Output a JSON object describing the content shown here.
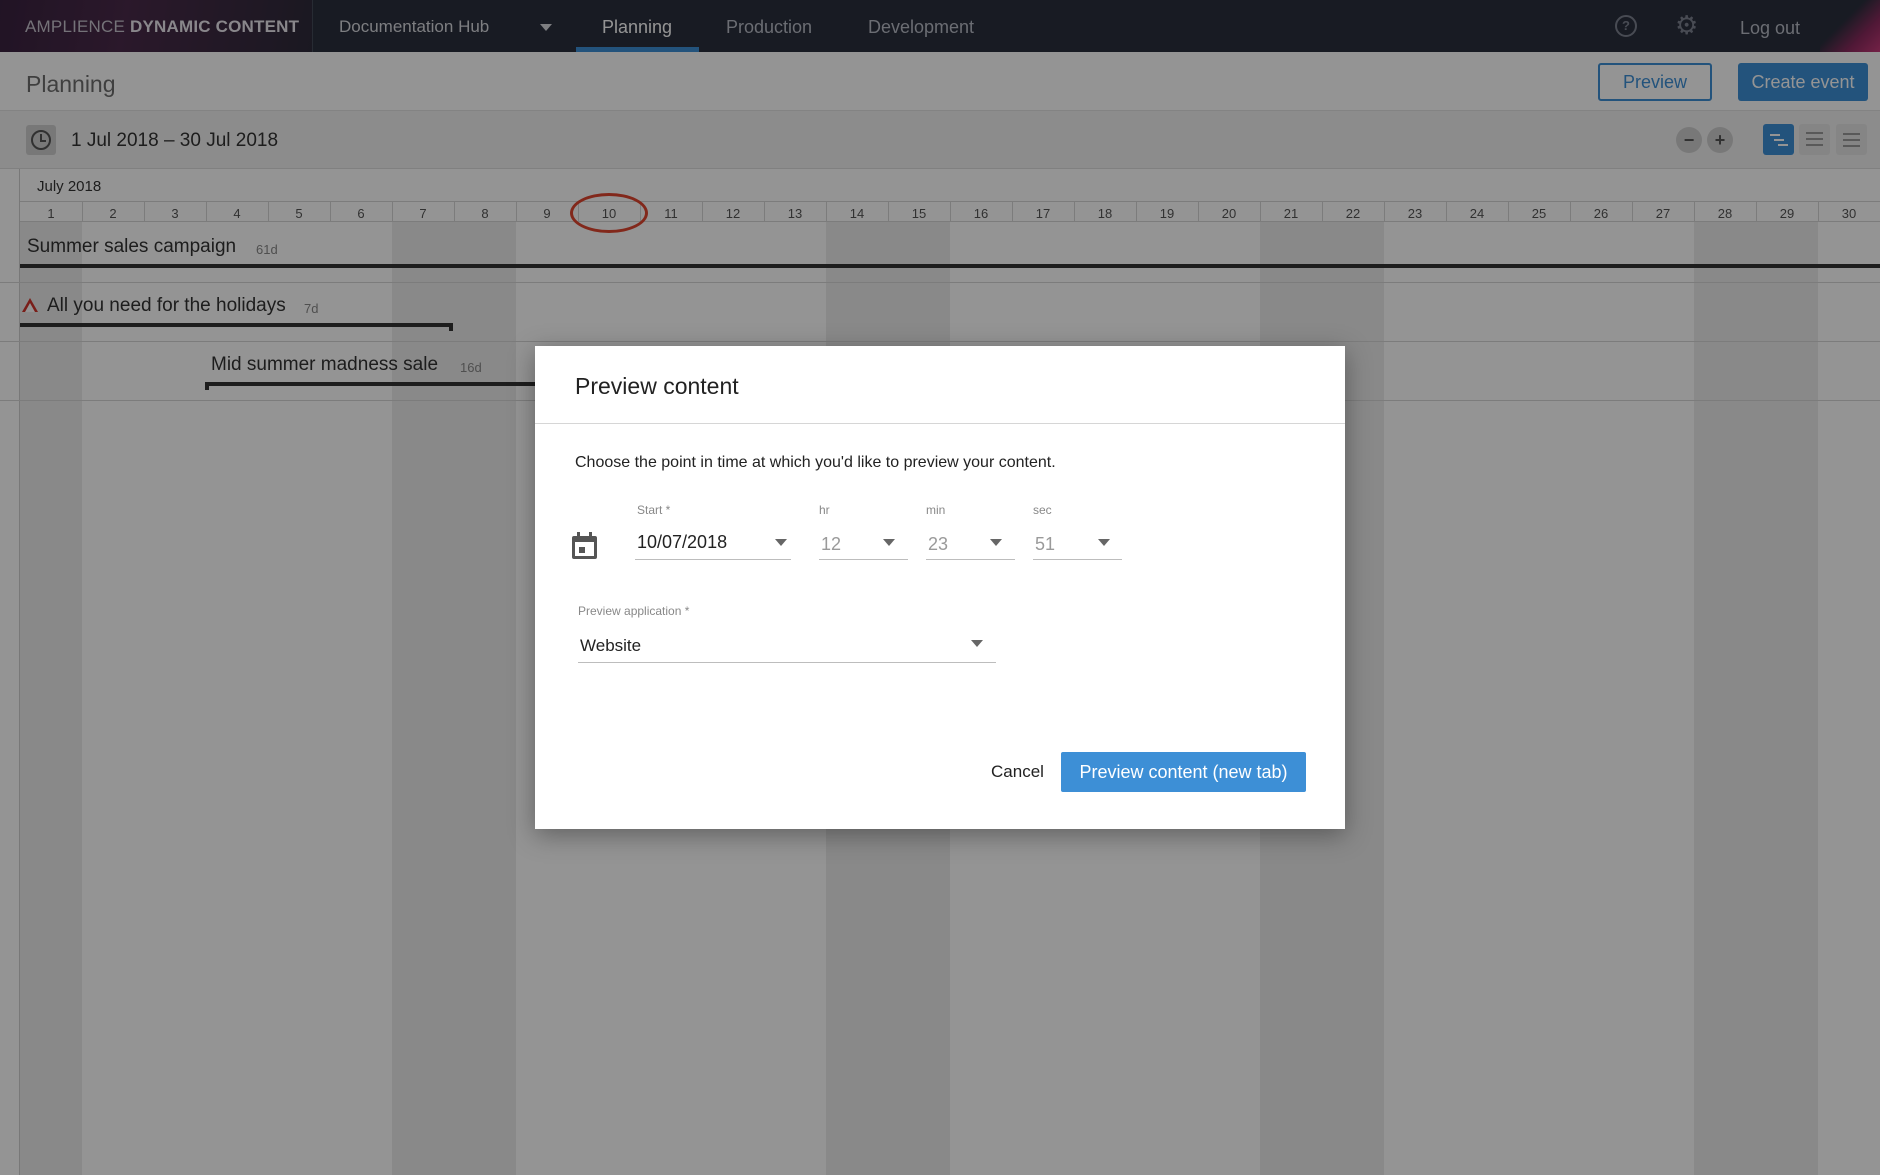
{
  "nav": {
    "brand_light": "AMPLIENCE",
    "brand_bold": "DYNAMIC CONTENT",
    "hub": "Documentation Hub",
    "tabs": [
      {
        "label": "Planning",
        "active": true
      },
      {
        "label": "Production",
        "active": false
      },
      {
        "label": "Development",
        "active": false
      }
    ],
    "help_icon": "?",
    "gear_icon": "⚙",
    "logout": "Log out"
  },
  "header": {
    "title": "Planning",
    "preview_label": "Preview",
    "create_label": "Create event"
  },
  "toolbar": {
    "date_range": "1 Jul 2018 – 30 Jul 2018",
    "zoom_out": "−",
    "zoom_in": "+"
  },
  "timeline": {
    "month": "July 2018",
    "days": [
      "1",
      "2",
      "3",
      "4",
      "5",
      "6",
      "7",
      "8",
      "9",
      "10",
      "11",
      "12",
      "13",
      "14",
      "15",
      "16",
      "17",
      "18",
      "19",
      "20",
      "21",
      "22",
      "23",
      "24",
      "25",
      "26",
      "27",
      "28",
      "29",
      "30"
    ],
    "highlighted_day": "10",
    "events": [
      {
        "name": "Summer sales campaign",
        "duration": "61d"
      },
      {
        "name": "All you need for the holidays",
        "duration": "7d",
        "warning": true
      },
      {
        "name": "Mid summer madness sale",
        "duration": "16d"
      }
    ]
  },
  "dialog": {
    "title": "Preview content",
    "description": "Choose the point in time at which you'd like to preview your content.",
    "start_label": "Start *",
    "start_value": "10/07/2018",
    "hr_label": "hr",
    "hr_value": "12",
    "min_label": "min",
    "min_value": "23",
    "sec_label": "sec",
    "sec_value": "51",
    "app_label": "Preview application *",
    "app_value": "Website",
    "cancel_label": "Cancel",
    "confirm_label": "Preview content (new tab)"
  },
  "colors": {
    "accent": "#3d8fd6",
    "nav_bg": "#2a2f3d",
    "warning": "#d0342c",
    "today_marker": "#e0452f"
  }
}
